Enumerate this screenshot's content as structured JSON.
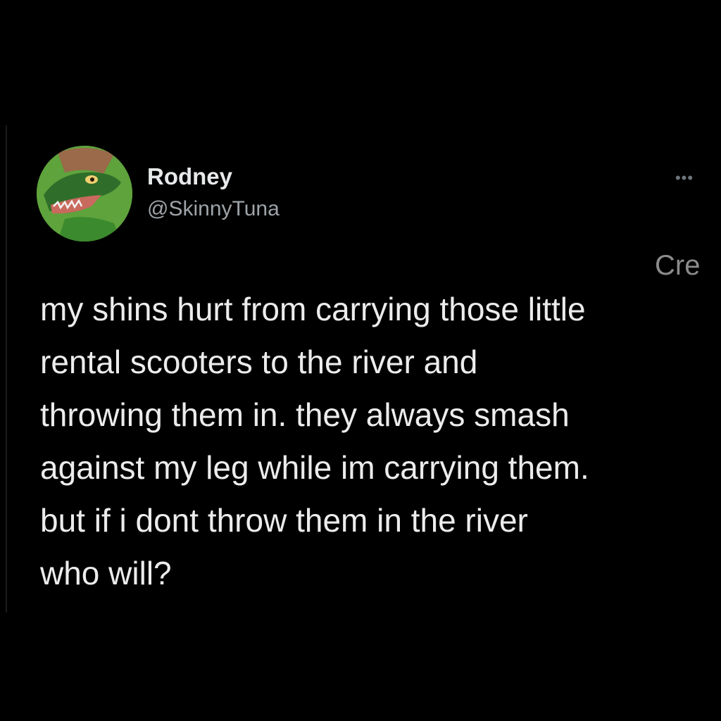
{
  "tweet": {
    "author": {
      "display_name": "Rodney",
      "handle": "@SkinnyTuna",
      "avatar_icon": "green-lizard-avatar"
    },
    "more_icon": "more-options-icon",
    "overlay_text": "Cre",
    "body_lines": [
      "my shins hurt from carrying those little",
      "rental scooters to the river and",
      "throwing them in. they always smash",
      "against my leg while im carrying them.",
      "but if i dont throw them in the river",
      "who will?"
    ]
  },
  "colors": {
    "background": "#000000",
    "text_primary": "#e7e9ea",
    "text_secondary": "#9ea3a8",
    "avatar_green": "#5ea33c"
  }
}
